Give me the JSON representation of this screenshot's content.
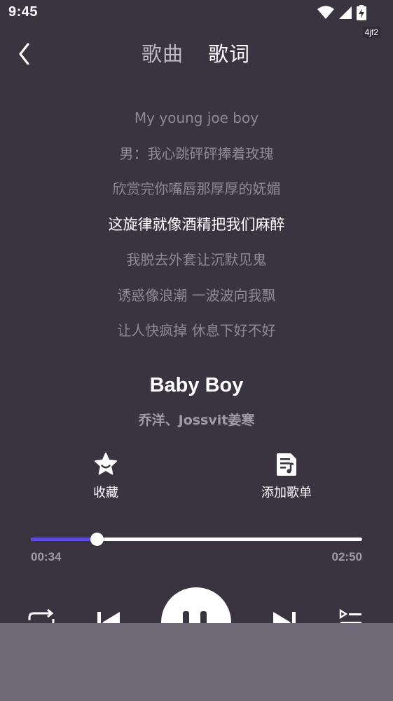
{
  "status_bar": {
    "time": "9:45",
    "icons": [
      "wifi-icon",
      "signal-icon",
      "battery-charging-icon"
    ]
  },
  "corner_tag": "4jf2",
  "header": {
    "back_icon": "chevron-left-icon",
    "tabs": [
      {
        "label": "歌曲",
        "active": false
      },
      {
        "label": "歌词",
        "active": true
      }
    ]
  },
  "lyrics": [
    {
      "text": "My young joe boy",
      "active": false
    },
    {
      "text": "男：我心跳砰砰捧着玫瑰",
      "active": false
    },
    {
      "text": "欣赏完你嘴唇那厚厚的妩媚",
      "active": false
    },
    {
      "text": "这旋律就像酒精把我们麻醉",
      "active": true
    },
    {
      "text": "我脱去外套让沉默见鬼",
      "active": false
    },
    {
      "text": "诱惑像浪潮  一波波向我飘",
      "active": false
    },
    {
      "text": "让人快疯掉  休息下好不好",
      "active": false
    }
  ],
  "song": {
    "title": "Baby Boy",
    "artist": "乔洋、Jossvit姜寒"
  },
  "actions": {
    "favorite": {
      "label": "收藏",
      "icon": "star-icon"
    },
    "add_to_playlist": {
      "label": "添加歌单",
      "icon": "playlist-add-icon"
    }
  },
  "playback": {
    "current_time": "00:34",
    "total_time": "02:50",
    "progress": 0.2
  },
  "controls": {
    "icons": [
      "repeat-icon",
      "previous-icon",
      "pause-icon",
      "next-icon",
      "queue-icon"
    ]
  },
  "colors": {
    "background": "#393440",
    "accent": "#5b4bdf",
    "muted_text": "#8f8996",
    "overlay": "#6e6976"
  }
}
